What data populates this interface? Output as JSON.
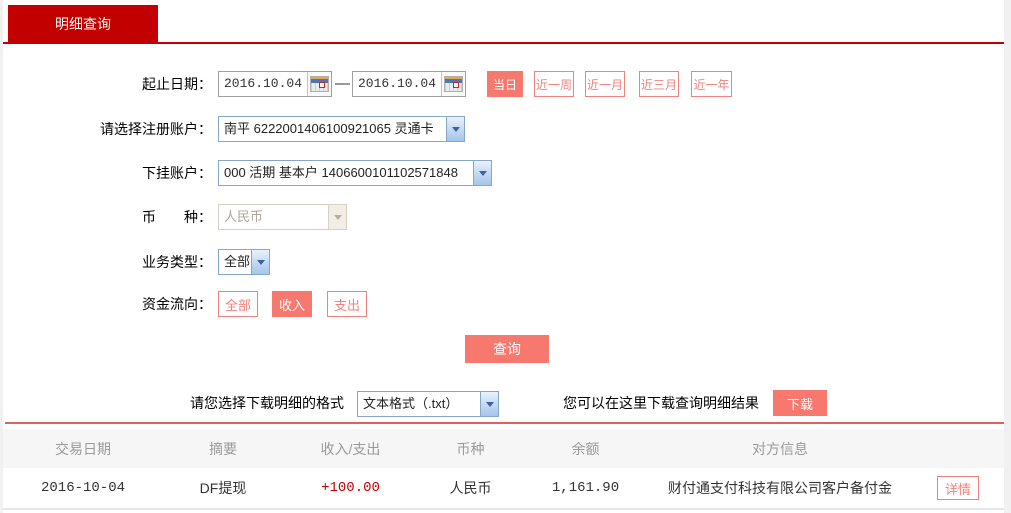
{
  "tabs": [
    {
      "label": "明细查询",
      "active": true
    }
  ],
  "form": {
    "date_range": {
      "label": "起止日期：",
      "start_value": "2016.10.04",
      "end_value": "2016.10.04",
      "separator": "—"
    },
    "quick_ranges": [
      {
        "label": "当日",
        "active": true
      },
      {
        "label": "近一周",
        "active": false
      },
      {
        "label": "近一月",
        "active": false
      },
      {
        "label": "近三月",
        "active": false
      },
      {
        "label": "近一年",
        "active": false
      }
    ],
    "register_account": {
      "label": "请选择注册账户：",
      "value": "南平 6222001406100921065 灵通卡"
    },
    "sub_account": {
      "label": "下挂账户：",
      "value": "000 活期 基本户 1406600101102571848"
    },
    "currency": {
      "label": "币　　种：",
      "value": "人民币",
      "disabled": true
    },
    "business_type": {
      "label": "业务类型：",
      "value": "全部"
    },
    "fund_flow": {
      "label": "资金流向：",
      "options": [
        {
          "label": "全部",
          "active": false
        },
        {
          "label": "收入",
          "active": true
        },
        {
          "label": "支出",
          "active": false
        }
      ]
    },
    "submit_label": "查询"
  },
  "download": {
    "format_label": "请您选择下载明细的格式",
    "format_value": "文本格式（.txt）",
    "hint": "您可以在这里下载查询明细结果",
    "button_label": "下载"
  },
  "table": {
    "headers": [
      "交易日期",
      "摘要",
      "收入/支出",
      "币种",
      "余额",
      "对方信息"
    ],
    "rows": [
      {
        "date": "2016-10-04",
        "summary": "DF提现",
        "amount": "+100.00",
        "currency": "人民币",
        "balance": "1,161.90",
        "counterparty": "财付通支付科技有限公司客户备付金",
        "action_label": "详情"
      }
    ]
  },
  "colors": {
    "brand_red": "#c30000",
    "accent_fill": "#f7786f",
    "accent_outline": "#f0837d",
    "amount_red": "#cc0000",
    "divider_red": "#e06060",
    "header_bg": "#f6f6f6",
    "header_text": "#9a9a9a"
  }
}
